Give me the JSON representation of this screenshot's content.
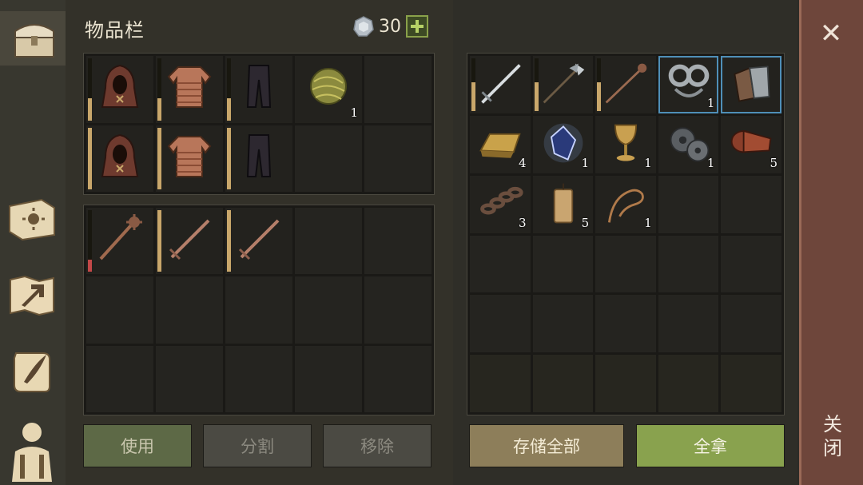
{
  "header": {
    "title": "物品栏",
    "currency_amount": "30",
    "add_label": "+"
  },
  "sidebar": {
    "tabs": [
      {
        "name": "chest-tab",
        "icon": "chest-icon",
        "active": true
      },
      {
        "name": "sun-book-tab",
        "icon": "sun-book-icon",
        "active": false
      },
      {
        "name": "map-tab",
        "icon": "map-arrow-icon",
        "active": false
      },
      {
        "name": "quest-scroll-tab",
        "icon": "scroll-quill-icon",
        "active": false
      },
      {
        "name": "character-tab",
        "icon": "character-silhouette-icon",
        "active": false
      }
    ]
  },
  "inventory_top": [
    {
      "icon": "hood",
      "durability": 0.35,
      "qty": ""
    },
    {
      "icon": "chainmail",
      "durability": 0.35,
      "qty": ""
    },
    {
      "icon": "leggings",
      "durability": 0.35,
      "qty": ""
    },
    {
      "icon": "plant-fiber-ball",
      "qty": "1"
    },
    {
      "icon": "empty"
    },
    {
      "icon": "hood",
      "durability": 1.0,
      "qty": ""
    },
    {
      "icon": "chainmail",
      "durability": 1.0,
      "qty": ""
    },
    {
      "icon": "leggings",
      "durability": 1.0,
      "qty": ""
    },
    {
      "icon": "empty"
    },
    {
      "icon": "empty"
    }
  ],
  "inventory_bottom": [
    {
      "icon": "mace",
      "durability": 0.2,
      "durability_color": "red",
      "qty": ""
    },
    {
      "icon": "sword",
      "durability": 1.0,
      "qty": ""
    },
    {
      "icon": "sword",
      "durability": 1.0,
      "qty": ""
    },
    {
      "icon": "empty"
    },
    {
      "icon": "empty"
    },
    {
      "icon": "empty"
    },
    {
      "icon": "empty"
    },
    {
      "icon": "empty"
    },
    {
      "icon": "empty"
    },
    {
      "icon": "empty"
    },
    {
      "icon": "empty"
    },
    {
      "icon": "empty"
    },
    {
      "icon": "empty"
    },
    {
      "icon": "empty"
    },
    {
      "icon": "empty"
    }
  ],
  "storage": [
    {
      "icon": "longsword",
      "durability": 0.55,
      "qty": ""
    },
    {
      "icon": "halberd",
      "durability": 0.55,
      "qty": ""
    },
    {
      "icon": "mace-spear",
      "durability": 0.55,
      "qty": ""
    },
    {
      "icon": "shackles",
      "qty": "1",
      "highlight": true
    },
    {
      "icon": "gauntlets",
      "qty": "",
      "highlight": true
    },
    {
      "icon": "gold-ingot",
      "qty": "4"
    },
    {
      "icon": "crystal",
      "qty": "1"
    },
    {
      "icon": "goblet",
      "qty": "1"
    },
    {
      "icon": "gears",
      "qty": "1"
    },
    {
      "icon": "leather-roll",
      "qty": "5"
    },
    {
      "icon": "chain",
      "qty": "3"
    },
    {
      "icon": "candle",
      "qty": "5"
    },
    {
      "icon": "rope",
      "qty": "1"
    },
    {
      "icon": "empty"
    },
    {
      "icon": "empty"
    },
    {
      "icon": "empty"
    },
    {
      "icon": "empty"
    },
    {
      "icon": "empty"
    },
    {
      "icon": "empty"
    },
    {
      "icon": "empty"
    },
    {
      "icon": "empty"
    },
    {
      "icon": "empty"
    },
    {
      "icon": "empty"
    },
    {
      "icon": "empty"
    },
    {
      "icon": "empty"
    },
    {
      "icon": "empty"
    },
    {
      "icon": "empty"
    },
    {
      "icon": "empty"
    },
    {
      "icon": "empty"
    },
    {
      "icon": "empty"
    }
  ],
  "buttons": {
    "use": "使用",
    "split": "分割",
    "remove": "移除",
    "store_all": "存储全部",
    "take_all": "全拿"
  },
  "close": {
    "x": "✕",
    "label": "关闭"
  },
  "colors": {
    "take_all": "#89a24e",
    "store_all": "#8d7e5a",
    "close_panel": "#6e463b",
    "durability": "#c9a76b",
    "durability_low": "#c34848"
  }
}
